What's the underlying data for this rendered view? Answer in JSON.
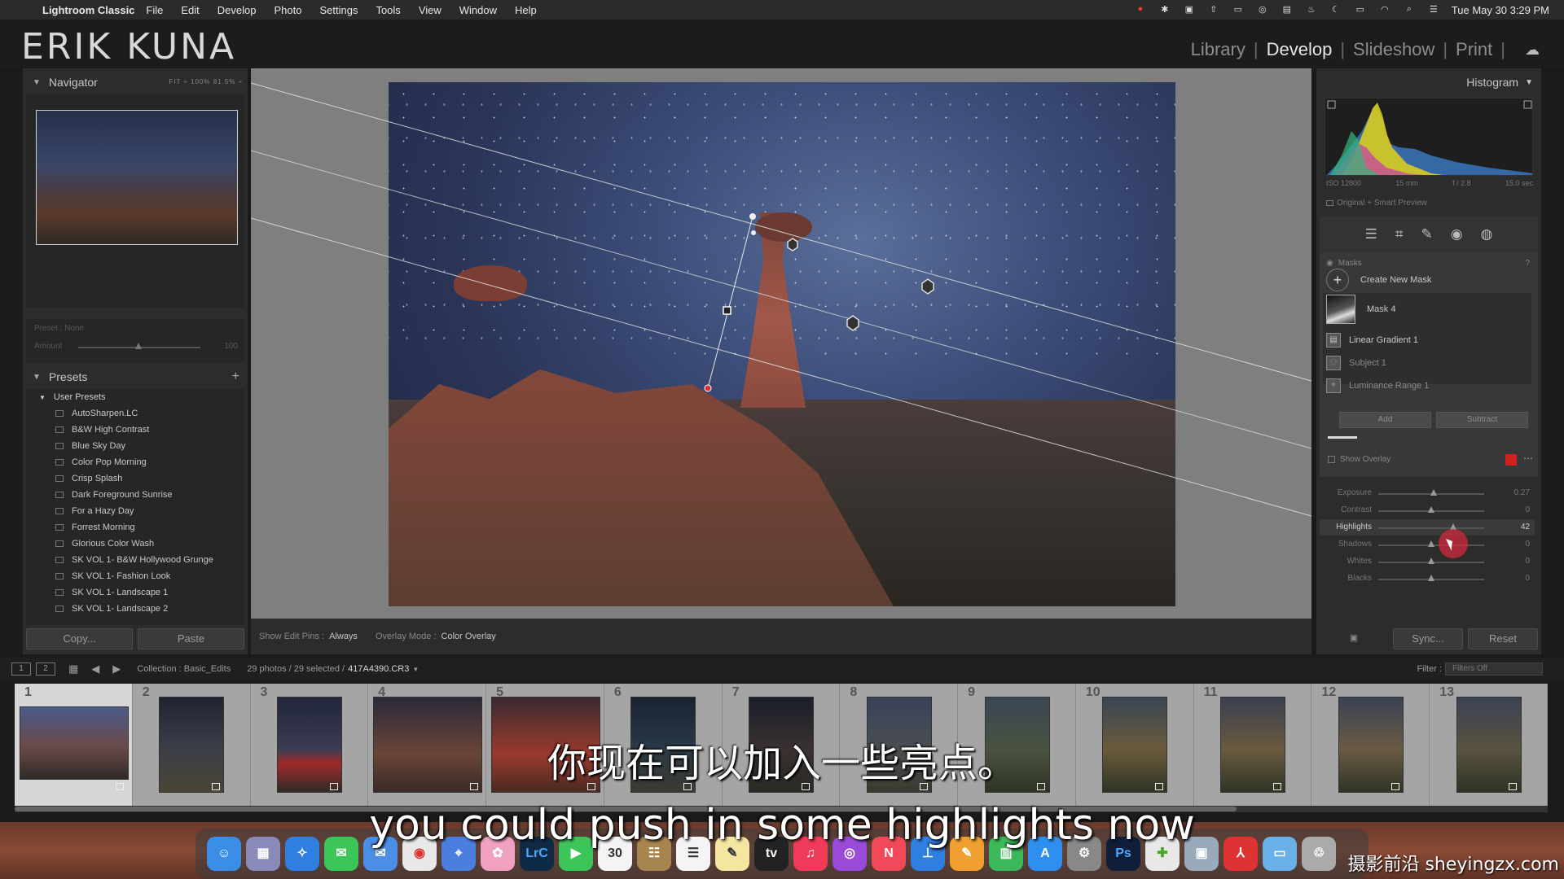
{
  "menubar": {
    "app_name": "Lightroom Classic",
    "items": [
      "File",
      "Edit",
      "Develop",
      "Photo",
      "Settings",
      "Tools",
      "View",
      "Window",
      "Help"
    ],
    "clock": "Tue May 30  3:29 PM"
  },
  "header": {
    "brand": "ERIK KUNA",
    "modules": [
      "Library",
      "Develop",
      "Slideshow",
      "Print"
    ],
    "active_module": "Develop"
  },
  "navigator": {
    "title": "Navigator",
    "zoom_options": "FIT ÷   100%   81.5% ÷",
    "preset_label": "Preset : None",
    "amount_label": "Amount",
    "amount_value": "100"
  },
  "presets": {
    "title": "Presets",
    "group": "User Presets",
    "items": [
      "AutoSharpen.LC",
      "B&W High Contrast",
      "Blue Sky Day",
      "Color Pop Morning",
      "Crisp Splash",
      "Dark Foreground Sunrise",
      "For a Hazy Day",
      "Forrest Morning",
      "Glorious Color Wash",
      "SK VOL 1- B&W Hollywood Grunge",
      "SK VOL 1- Fashion Look",
      "SK VOL 1- Landscape 1",
      "SK VOL 1- Landscape 2"
    ],
    "copy_label": "Copy...",
    "paste_label": "Paste"
  },
  "toolbar": {
    "show_edit_pins_label": "Show Edit Pins :",
    "show_edit_pins_value": "Always",
    "overlay_mode_label": "Overlay Mode :",
    "overlay_mode_value": "Color Overlay"
  },
  "histogram": {
    "title": "Histogram",
    "iso": "ISO 12800",
    "focal": "15 mm",
    "aperture": "f / 2.8",
    "shutter": "15.0 sec",
    "preview_label": "Original + Smart Preview"
  },
  "masks": {
    "title": "Masks",
    "create_label": "Create New Mask",
    "mask_name": "Mask 4",
    "components": [
      "Linear Gradient 1",
      "Subject 1",
      "Luminance Range 1"
    ],
    "add_label": "Add",
    "subtract_label": "Subtract",
    "show_overlay_label": "Show Overlay",
    "overlay_color": "#d41f1f"
  },
  "adjustments": [
    {
      "name": "Exposure",
      "value": "0.27",
      "position": 0.52
    },
    {
      "name": "Contrast",
      "value": "0",
      "position": 0.5
    },
    {
      "name": "Highlights",
      "value": "42",
      "position": 0.71
    },
    {
      "name": "Shadows",
      "value": "0",
      "position": 0.5
    },
    {
      "name": "Whites",
      "value": "0",
      "position": 0.5
    },
    {
      "name": "Blacks",
      "value": "0",
      "position": 0.5
    }
  ],
  "right_buttons": {
    "sync_label": "Sync...",
    "reset_label": "Reset"
  },
  "filmbar": {
    "view1": "1",
    "view2": "2",
    "collection": "Collection : Basic_Edits",
    "count": "29 photos / 29 selected /",
    "file": "417A4390.CR3",
    "filter_label": "Filter :",
    "filter_value": "Filters Off"
  },
  "filmstrip": {
    "numbers": [
      "1",
      "2",
      "3",
      "4",
      "5",
      "6",
      "7",
      "8",
      "9",
      "10",
      "11",
      "12",
      "13"
    ]
  },
  "dock": {
    "lrc_label": "LrC",
    "ps_label": "Ps",
    "calendar_day": "30",
    "tv_label": "tv"
  },
  "subtitles": {
    "zh": "你现在可以加入一些亮点。",
    "en": "you could push in some highlights now"
  },
  "watermark": "摄影前沿 sheyingzx.com"
}
